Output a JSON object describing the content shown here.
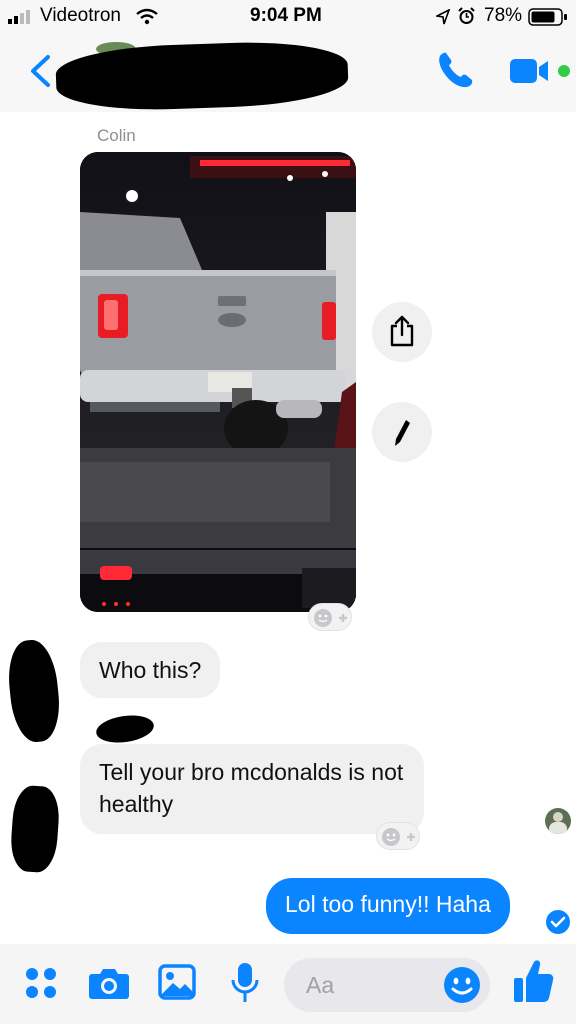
{
  "status_bar": {
    "carrier": "Videotron",
    "time": "9:04 PM",
    "battery": "78%"
  },
  "thread": {
    "sender_name": "Colin",
    "messages_in": [
      {
        "text": "Who this?"
      },
      {
        "text": "Tell your bro mcdonalds is not healthy"
      }
    ],
    "message_out": {
      "text": "Lol too funny!! Haha"
    }
  },
  "composer": {
    "placeholder": "Aa"
  },
  "colors": {
    "accent": "#0a84ff",
    "incoming_bubble": "#f0f0f0",
    "online": "#31cc46"
  },
  "icons": [
    "back-chevron-icon",
    "phone-icon",
    "video-camera-icon",
    "share-icon",
    "pencil-icon",
    "add-reaction-icon",
    "apps-icon",
    "camera-icon",
    "image-icon",
    "microphone-icon",
    "emoji-icon",
    "thumbs-up-icon",
    "read-receipt-icon"
  ]
}
